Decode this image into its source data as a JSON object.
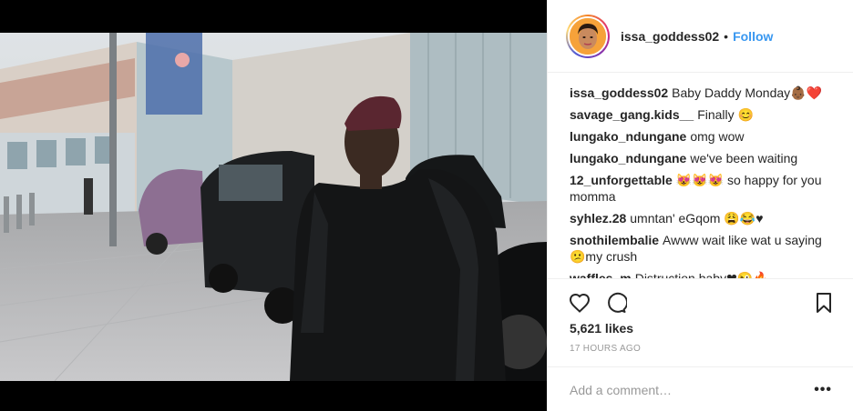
{
  "post": {
    "username": "issa_goddess02",
    "follow_label": "Follow",
    "dot": "•"
  },
  "comments": [
    {
      "user": "issa_goddess02",
      "text": "Baby Daddy Monday👶🏾❤️"
    },
    {
      "user": "savage_gang.kids__",
      "text": "Finally 😊"
    },
    {
      "user": "lungako_ndungane",
      "text": "omg wow"
    },
    {
      "user": "lungako_ndungane",
      "text": "we've been waiting"
    },
    {
      "user": "12_unforgettable",
      "text": "😻😻😻 so happy for you momma"
    },
    {
      "user": "syhlez.28",
      "text": "umntan' eGqom 😩😂♥"
    },
    {
      "user": "snothilembalie",
      "text": "Awww wait like wat u saying 😕my crush"
    },
    {
      "user": "waffles_m",
      "text": "Distruction baby❤😜🔥"
    }
  ],
  "stats": {
    "likes": "5,621 likes",
    "time": "17 HOURS AGO"
  },
  "add_comment": {
    "placeholder": "Add a comment…",
    "more": "•••"
  },
  "icons": {
    "like": "heart-icon",
    "comment": "comment-bubble-icon",
    "save": "bookmark-icon"
  }
}
